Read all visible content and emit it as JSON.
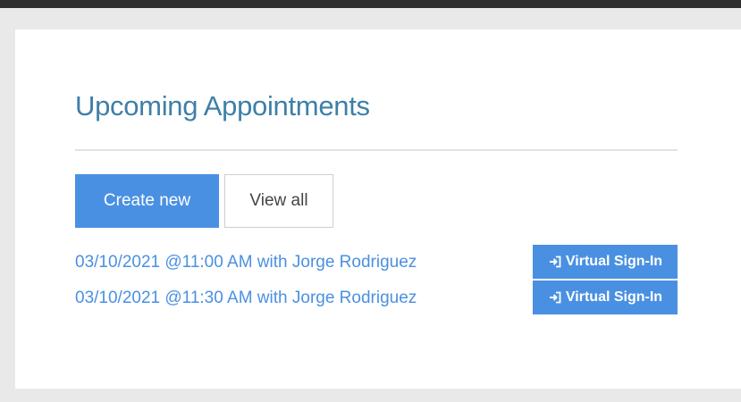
{
  "panel": {
    "title": "Upcoming Appointments"
  },
  "actions": {
    "create_label": "Create new",
    "view_all_label": "View all"
  },
  "appointments": [
    {
      "text": "03/10/2021 @11:00 AM with Jorge Rodriguez",
      "button_label": "Virtual Sign-In",
      "button_icon": "sign-in-icon"
    },
    {
      "text": "03/10/2021 @11:30 AM with Jorge Rodriguez",
      "button_label": "Virtual Sign-In",
      "button_icon": "sign-in-icon"
    }
  ],
  "colors": {
    "accent": "#4a90e2",
    "title": "#3e7fa8",
    "background": "#e9e9e9",
    "top_bar": "#2f2f2f"
  }
}
